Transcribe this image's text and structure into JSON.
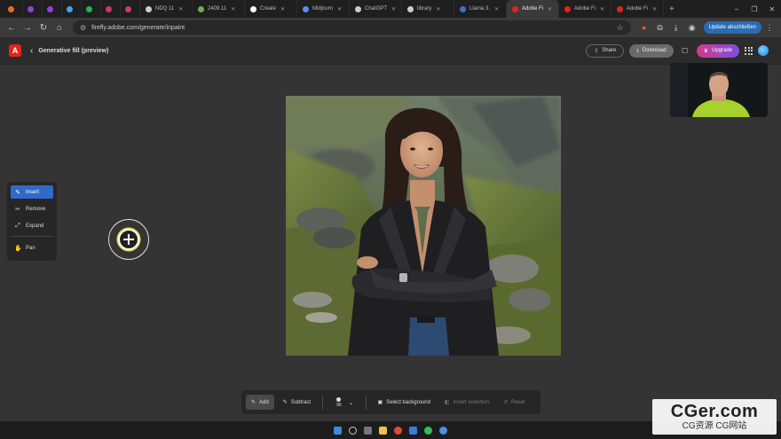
{
  "browser": {
    "tabs": [
      {
        "label": "",
        "color": "#e66b2e",
        "kind": "small"
      },
      {
        "label": "",
        "color": "#8e44d6",
        "kind": "small"
      },
      {
        "label": "",
        "color": "#8e44d6",
        "kind": "small"
      },
      {
        "label": "",
        "color": "#4aa3df",
        "kind": "small"
      },
      {
        "label": "",
        "color": "#26b34f",
        "kind": "small"
      },
      {
        "label": "",
        "color": "#c23a7a",
        "kind": "small"
      },
      {
        "label": "",
        "color": "#c23a7a",
        "kind": "small"
      },
      {
        "label": "NDQ 11",
        "color": "#cfcfcf",
        "kind": "mid"
      },
      {
        "label": "2409.11",
        "color": "#6ab04c",
        "kind": "mid"
      },
      {
        "label": "Create",
        "color": "#ffffff",
        "kind": "mid"
      },
      {
        "label": "Midjourn",
        "color": "#5b8def",
        "kind": "mid"
      },
      {
        "label": "ChatGPT",
        "color": "#cccccc",
        "kind": "mid"
      },
      {
        "label": "library",
        "color": "#cccccc",
        "kind": "mid"
      },
      {
        "label": "Llama 3.",
        "color": "#3b6fd4",
        "kind": "mid"
      },
      {
        "label": "Adobe Fi",
        "color": "#e1251b",
        "kind": "mid",
        "active": true
      },
      {
        "label": "Adobe Fi",
        "color": "#e1251b",
        "kind": "mid"
      },
      {
        "label": "Adobe Fi",
        "color": "#e1251b",
        "kind": "mid"
      }
    ],
    "new_tab": "+",
    "window_controls": {
      "minimize": "–",
      "maximize": "❐",
      "close": "✕"
    },
    "url": "firefly.adobe.com/generate/inpaint",
    "update_label": "Update abschließen",
    "nav": {
      "back": "←",
      "forward": "→",
      "reload": "↻",
      "home": "⌂"
    }
  },
  "app": {
    "title": "Generative fill (preview)",
    "share_label": "Share",
    "download_label": "Download",
    "upgrade_label": "Upgrade"
  },
  "tools": {
    "insert": "Insert",
    "remove": "Remove",
    "expand": "Expand",
    "pan": "Pan"
  },
  "bottom_toolbar": {
    "add": "Add",
    "subtract": "Subtract",
    "brush_size": "96",
    "select_background": "Select background",
    "invert_selection": "Invert selection",
    "reset": "Reset"
  },
  "watermark": {
    "main": "CGer.com",
    "sub": "CG资源  CG网站"
  },
  "colors": {
    "accent_blue": "#2f69c9",
    "adobe_red": "#e1251b",
    "cursor_ring": "#e9e250"
  }
}
